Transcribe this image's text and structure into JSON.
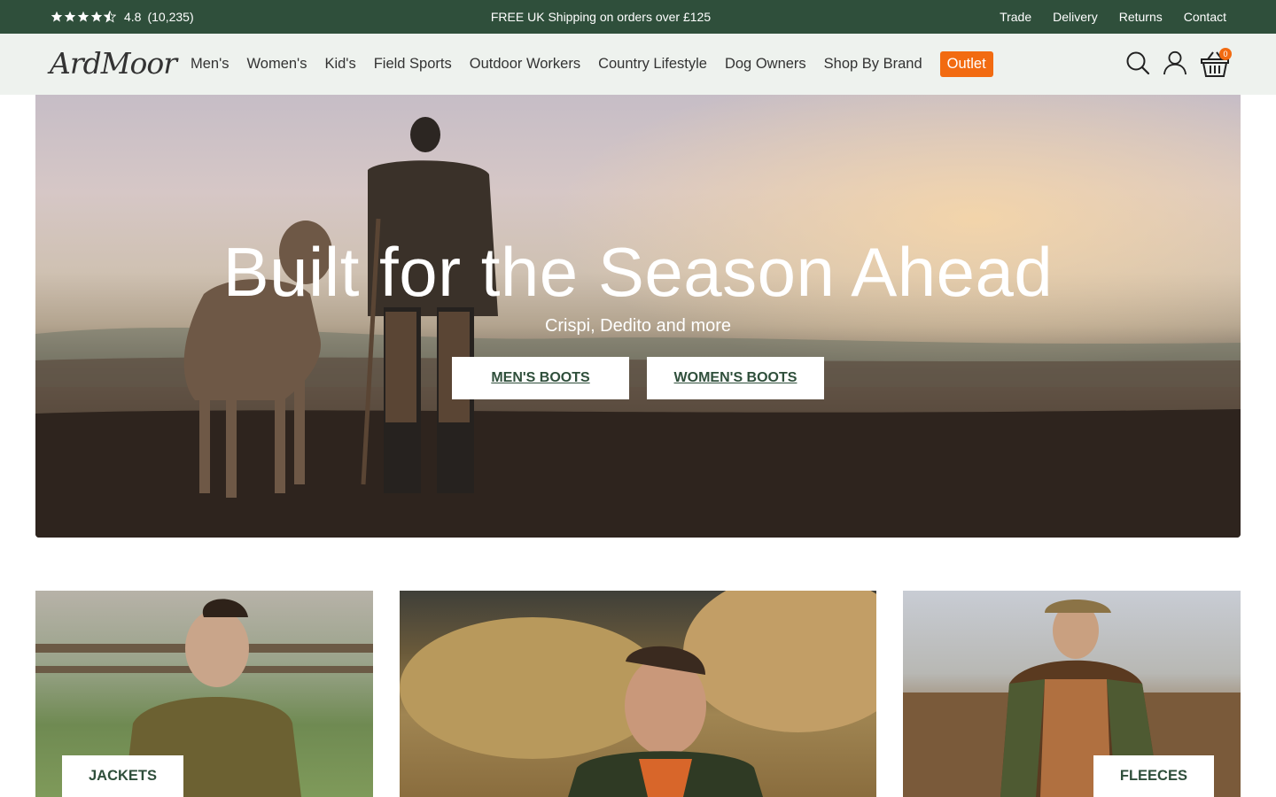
{
  "topbar": {
    "rating_score": "4.8",
    "rating_count": "(10,235)",
    "shipping": "FREE UK Shipping on orders over £125",
    "links": [
      "Trade",
      "Delivery",
      "Returns",
      "Contact"
    ]
  },
  "header": {
    "logo": "ArdMoor",
    "nav": [
      "Men's",
      "Women's",
      "Kid's",
      "Field Sports",
      "Outdoor Workers",
      "Country Lifestyle",
      "Dog Owners",
      "Shop By Brand"
    ],
    "outlet": "Outlet",
    "basket_count": "0"
  },
  "hero": {
    "title": "Built for the Season Ahead",
    "subtitle": "Crispi, Dedito and more",
    "buttons": [
      "MEN'S BOOTS",
      "WOMEN'S BOOTS"
    ]
  },
  "tiles": [
    {
      "label": "JACKETS"
    },
    {
      "label": ""
    },
    {
      "label": "FLEECES"
    }
  ],
  "colors": {
    "topbar": "#2f4f3b",
    "header_bg": "#eef2ee",
    "accent": "#f26b11",
    "button_text": "#2f4f3b"
  }
}
